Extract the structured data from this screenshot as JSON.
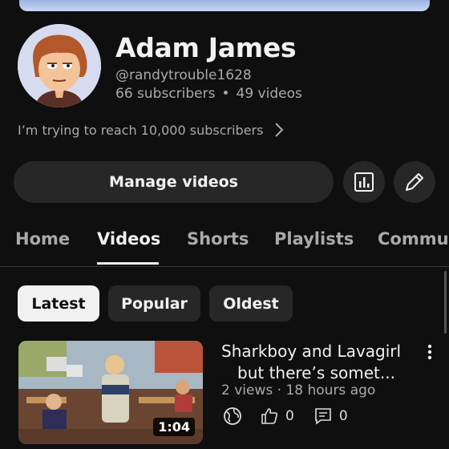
{
  "channel": {
    "name": "Adam James",
    "handle": "@randytrouble1628",
    "subscribers": "66 subscribers",
    "separator": "•",
    "videos_count": "49 videos",
    "description": "I’m trying to reach 10,000 subscribers"
  },
  "actions": {
    "manage_label": "Manage videos",
    "analytics_icon": "bar-chart-icon",
    "edit_icon": "pencil-icon"
  },
  "tabs": [
    {
      "label": "Home"
    },
    {
      "label": "Videos"
    },
    {
      "label": "Shorts"
    },
    {
      "label": "Playlists"
    },
    {
      "label": "Commu"
    }
  ],
  "filters": [
    {
      "label": "Latest"
    },
    {
      "label": "Popular"
    },
    {
      "label": "Oldest"
    }
  ],
  "video": {
    "title_line1": "Sharkboy and Lavagirl",
    "title_line2": "but there’s somet...",
    "views": "2 views",
    "dot": "·",
    "age": "18 hours ago",
    "duration": "1:04",
    "likes": "0",
    "comments": "0",
    "visibility_icon": "globe-icon"
  },
  "colors": {
    "background": "#0f0f0f",
    "surface": "#272727",
    "text_primary": "#f1f1f1",
    "text_secondary": "#aaaaaa"
  }
}
